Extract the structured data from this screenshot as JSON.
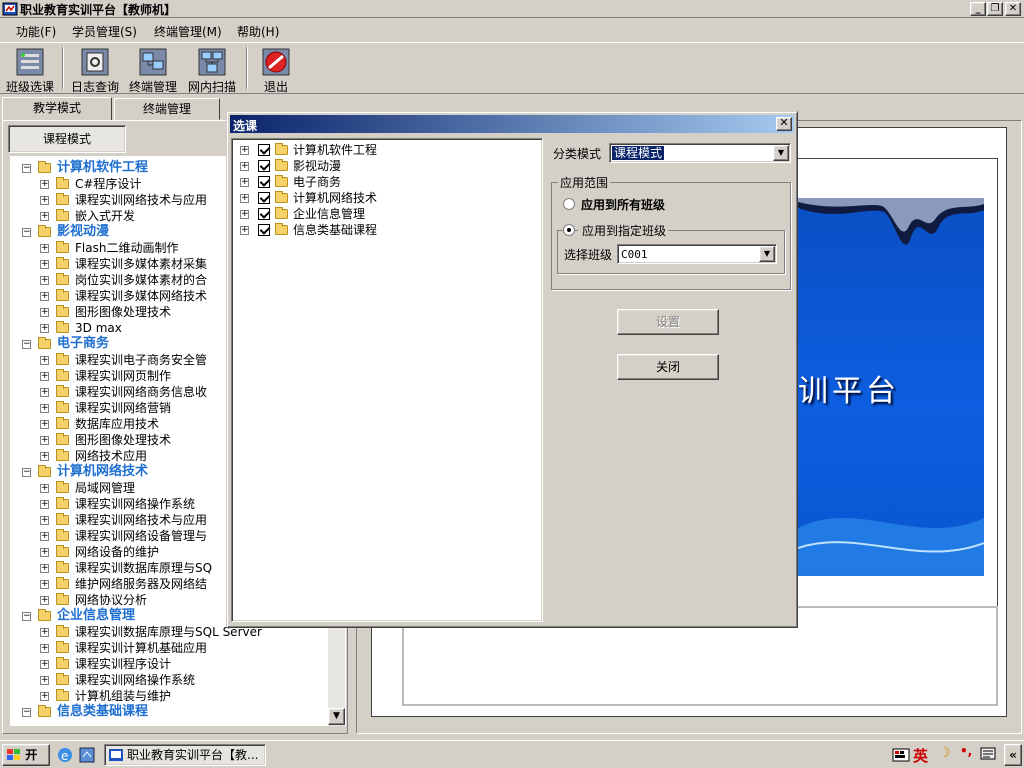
{
  "window": {
    "title": "职业教育实训平台【教师机】"
  },
  "menu": [
    "功能(F)",
    "学员管理(S)",
    "终端管理(M)",
    "帮助(H)"
  ],
  "toolbar": {
    "buttons": [
      {
        "label": "班级选课",
        "icon": "class-select-icon"
      },
      {
        "label": "日志查询",
        "icon": "log-query-icon"
      },
      {
        "label": "终端管理",
        "icon": "terminal-manage-icon"
      },
      {
        "label": "网内扫描",
        "icon": "network-scan-icon"
      },
      {
        "label": "退出",
        "icon": "exit-icon"
      }
    ]
  },
  "tabs": [
    {
      "label": "教学模式",
      "active": true
    },
    {
      "label": "终端管理",
      "active": false
    }
  ],
  "left": {
    "mode_button": "课程模式",
    "tree": [
      {
        "label": "计算机软件工程",
        "children": [
          "C#程序设计",
          "课程实训网络技术与应用",
          "嵌入式开发"
        ]
      },
      {
        "label": "影视动漫",
        "children": [
          "Flash二维动画制作",
          "课程实训多媒体素材采集",
          "岗位实训多媒体素材的合",
          "课程实训多媒体网络技术",
          "图形图像处理技术",
          "3D max"
        ]
      },
      {
        "label": "电子商务",
        "children": [
          "课程实训电子商务安全管",
          "课程实训网页制作",
          "课程实训网络商务信息收",
          "课程实训网络营销",
          "数据库应用技术",
          "图形图像处理技术",
          "网络技术应用"
        ]
      },
      {
        "label": "计算机网络技术",
        "children": [
          "局域网管理",
          "课程实训网络操作系统",
          "课程实训网络技术与应用",
          "课程实训网络设备管理与",
          "网络设备的维护",
          "课程实训数据库原理与SQ",
          "维护网络服务器及网络结",
          "网络协议分析"
        ]
      },
      {
        "label": "企业信息管理",
        "children": [
          "课程实训数据库原理与SQL Server",
          "课程实训计算机基础应用",
          "课程实训程序设计",
          "课程实训网络操作系统",
          "计算机组装与维护"
        ]
      },
      {
        "label": "信息类基础课程",
        "children": []
      }
    ]
  },
  "splash": {
    "text": "训平台"
  },
  "dialog": {
    "title": "选课",
    "courses": [
      "计算机软件工程",
      "影视动漫",
      "电子商务",
      "计算机网络技术",
      "企业信息管理",
      "信息类基础课程"
    ],
    "category_label": "分类模式",
    "category_value": "课程模式",
    "scope_legend": "应用范围",
    "radio_all": "应用到所有班级",
    "radio_specific": "应用到指定班级",
    "class_label": "选择班级",
    "class_value": "C001",
    "set_button": "设置",
    "close_button": "关闭"
  },
  "taskbar": {
    "start": "开始",
    "task": "职业教育实训平台【教...",
    "ime": "英"
  },
  "colors": {
    "caption_start": "#0a246a",
    "caption_end": "#a6caf0",
    "category_text": "#1f6fd0",
    "splash_blue": "#0a4fc4"
  }
}
